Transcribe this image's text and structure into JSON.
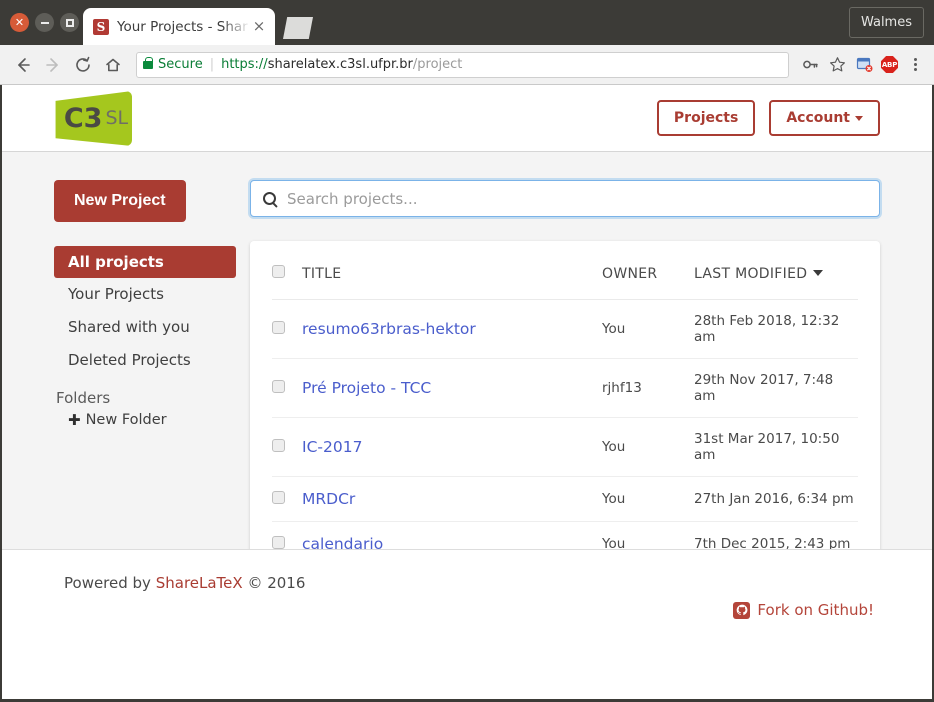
{
  "browser": {
    "window_user": "Walmes",
    "window_controls": [
      "close",
      "minimize",
      "maximize"
    ],
    "tab": {
      "title": "Your Projects - Shar",
      "favicon_letter": "S",
      "close_label": "×"
    },
    "new_tab_label": "",
    "toolbar": {
      "back_icon": "←",
      "forward_icon": "→",
      "reload_icon": "⟳",
      "home_icon": "⌂",
      "security_label": "Secure",
      "url_scheme": "https://",
      "url_host": "sharelatex.c3sl.ufpr.br",
      "url_path": "/project",
      "key_icon": "⚷",
      "star_icon": "☆",
      "extension_badge": "",
      "adblock_label": "ABP",
      "menu_icon": "kebab"
    }
  },
  "site_nav": {
    "logo_primary": "C3",
    "logo_secondary": "SL",
    "projects_label": "Projects",
    "account_label": "Account"
  },
  "sidebar": {
    "new_project_label": "New Project",
    "items": [
      {
        "label": "All projects",
        "active": true
      },
      {
        "label": "Your Projects",
        "active": false
      },
      {
        "label": "Shared with you",
        "active": false
      },
      {
        "label": "Deleted Projects",
        "active": false
      }
    ],
    "folders_heading": "Folders",
    "new_folder_label": "New Folder",
    "new_folder_icon": "✚"
  },
  "search": {
    "placeholder": "Search projects...",
    "value": ""
  },
  "projects_table": {
    "columns": {
      "title": "TITLE",
      "owner": "OWNER",
      "last_modified": "LAST MODIFIED"
    },
    "sorted_by": "LAST MODIFIED",
    "sort_direction": "desc",
    "rows": [
      {
        "title": "resumo63rbras-hektor",
        "owner": "You",
        "modified": "28th Feb 2018, 12:32 am"
      },
      {
        "title": "Pré Projeto - TCC",
        "owner": "rjhf13",
        "modified": "29th Nov 2017, 7:48 am"
      },
      {
        "title": "IC-2017",
        "owner": "You",
        "modified": "31st Mar 2017, 10:50 am"
      },
      {
        "title": "MRDCr",
        "owner": "You",
        "modified": "27th Jan 2016, 6:34 pm"
      },
      {
        "title": "calendario",
        "owner": "You",
        "modified": "7th Dec 2015, 2:43 pm"
      }
    ]
  },
  "footer": {
    "powered_prefix": "Powered by ",
    "brand": "ShareLaTeX",
    "copyright": " © 2016",
    "fork_label": "Fork on Github!"
  },
  "colors": {
    "brand_red": "#a93c32",
    "logo_green": "#a5c71e",
    "link_blue": "#4a5dcc",
    "secure_green": "#0a7d36",
    "content_bg": "#f4f4f4"
  }
}
